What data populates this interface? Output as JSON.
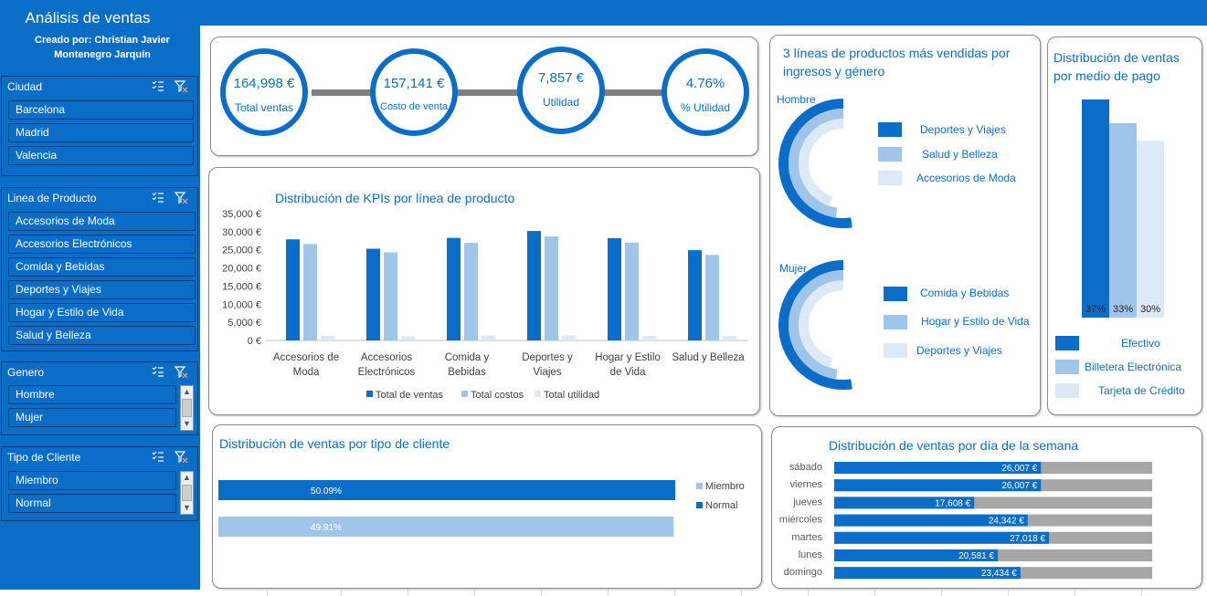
{
  "header": {
    "title": "Análisis de ventas",
    "author": "Creado por: Christian Javier Montenegro Jarquín"
  },
  "colors": {
    "dark": "#0a6ec8",
    "mid": "#9fc5eb",
    "light": "#dde9f7",
    "gray": "#a6a6a6"
  },
  "icons": {
    "multiselect": "multi-select-icon",
    "clear": "clear-filter-icon"
  },
  "slicers": [
    {
      "title": "Ciudad",
      "items": [
        "Barcelona",
        "Madrid",
        "Valencia"
      ]
    },
    {
      "title": "Linea de Producto",
      "items": [
        "Accesorios de Moda",
        "Accesorios Electrónicos",
        "Comida y Bebidas",
        "Deportes y Viajes",
        "Hogar y Estilo de Vida",
        "Salud y Belleza"
      ]
    },
    {
      "title": "Genero",
      "items": [
        "Hombre",
        "Mujer"
      ]
    },
    {
      "title": "Tipo de Cliente",
      "items": [
        "Miembro",
        "Normal"
      ]
    }
  ],
  "kpis": [
    {
      "value": "164,998 €",
      "label": "Total ventas"
    },
    {
      "value": "157,141 €",
      "label": "Costo de venta"
    },
    {
      "value": "7,857 €",
      "label": "Utilidad"
    },
    {
      "value": "4.76%",
      "label": "% Utilidad"
    }
  ],
  "kpi_chart": {
    "title": "Distribución de KPIs por línea de producto",
    "chart_data": {
      "type": "bar",
      "categories": [
        "Accesorios de Moda",
        "Accesorios Electrónicos",
        "Comida y Bebidas",
        "Deportes y Viajes",
        "Hogar y Estilo de Vida",
        "Salud y Belleza"
      ],
      "category_lines": [
        [
          "Accesorios de",
          "Moda"
        ],
        [
          "Accesorios",
          "Electrónicos"
        ],
        [
          "Comida y",
          "Bebidas"
        ],
        [
          "Deportes y",
          "Viajes"
        ],
        [
          "Hogar y Estilo",
          "de Vida"
        ],
        [
          "Salud y Belleza"
        ]
      ],
      "series": [
        {
          "name": "Total de ventas",
          "values": [
            27900,
            25300,
            28300,
            30200,
            28200,
            24900
          ]
        },
        {
          "name": "Total costos",
          "values": [
            26600,
            24300,
            26900,
            28700,
            27000,
            23600
          ]
        },
        {
          "name": "Total utilidad",
          "values": [
            1300,
            1100,
            1400,
            1400,
            1300,
            1200
          ]
        }
      ],
      "ylim": [
        0,
        35000
      ],
      "yticks": [
        "35,000 €",
        "30,000 €",
        "25,000 €",
        "20,000 €",
        "15,000 €",
        "10,000 €",
        "5,000 €",
        "0 €"
      ],
      "legend": "bottom"
    }
  },
  "gender_chart": {
    "title": "3 líneas de productos más vendidas por ingresos y género",
    "chart_data": {
      "type": "doughnut",
      "groups": [
        {
          "label": "Hombre",
          "series": [
            {
              "name": "Deportes y Viajes",
              "fraction": 0.36
            },
            {
              "name": "Salud y Belleza",
              "fraction": 0.33
            },
            {
              "name": "Accesorios de Moda",
              "fraction": 0.31
            }
          ]
        },
        {
          "label": "Mujer",
          "series": [
            {
              "name": "Comida y Bebidas",
              "fraction": 0.36
            },
            {
              "name": "Hogar y Estilo de Vida",
              "fraction": 0.33
            },
            {
              "name": "Deportes y Viajes",
              "fraction": 0.31
            }
          ]
        }
      ]
    }
  },
  "payment_chart": {
    "title": "Distribución de ventas por medio de pago",
    "chart_data": {
      "type": "bar",
      "categories": [
        "Efectivo",
        "Billetera Electrónica",
        "Tarjeta de Crédito"
      ],
      "values": [
        37,
        33,
        30
      ],
      "data_labels": [
        "37%",
        "33%",
        "30%"
      ],
      "legend": "bottom"
    }
  },
  "customer_chart": {
    "title": "Distribución de ventas por tipo de cliente",
    "chart_data": {
      "type": "bar",
      "orientation": "horizontal",
      "series": [
        {
          "name": "Normal",
          "value": 50.09,
          "label": "50.09%"
        },
        {
          "name": "Miembro",
          "value": 49.91,
          "label": "49.91%"
        }
      ],
      "legend_order": [
        "Miembro",
        "Normal"
      ],
      "legend": "right"
    }
  },
  "weekday_chart": {
    "title": "Distribución de ventas por día de la semana",
    "chart_data": {
      "type": "bar",
      "orientation": "horizontal",
      "categories": [
        "sábado",
        "viernes",
        "jueves",
        "miércoles",
        "martes",
        "lunes",
        "domingo"
      ],
      "values": [
        26007,
        26007,
        17608,
        24342,
        27018,
        20581,
        23434
      ],
      "data_labels": [
        "26,007 €",
        "26,007 €",
        "17,608 €",
        "24,342 €",
        "27,018 €",
        "20,581 €",
        "23,434 €"
      ],
      "xlim": [
        0,
        40000
      ]
    }
  }
}
